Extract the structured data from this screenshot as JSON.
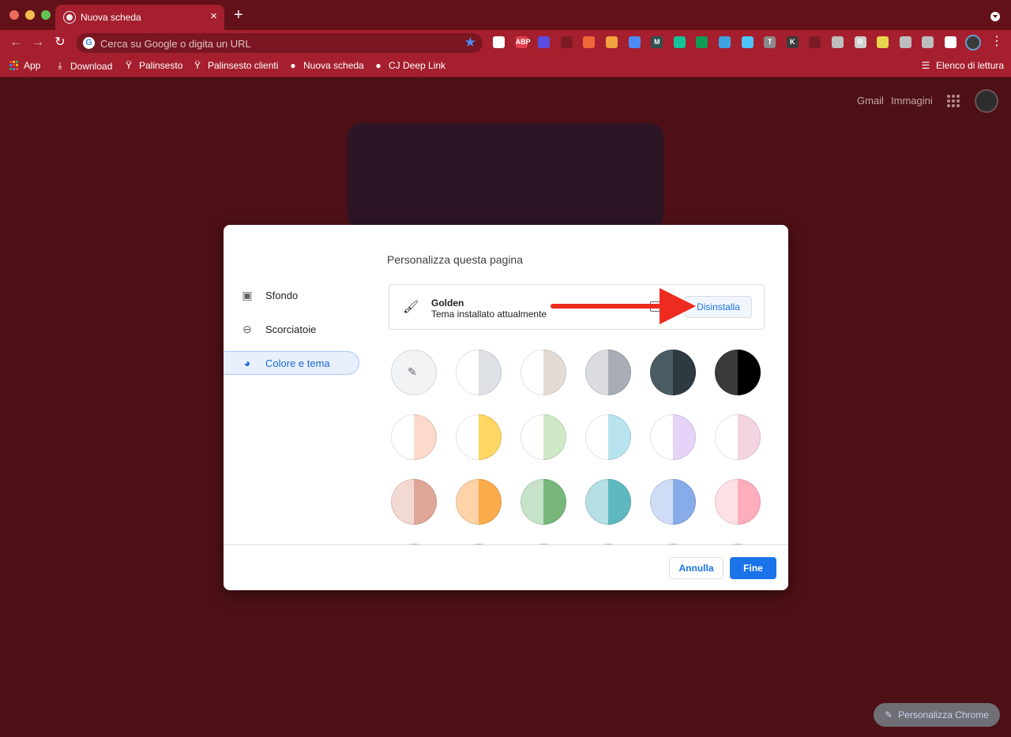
{
  "browser": {
    "tab_title": "Nuova scheda",
    "tab_close": "×",
    "new_tab": "+",
    "omnibox_placeholder": "Cerca su Google o digita un URL",
    "bookmarks": [
      "App",
      "Download",
      "Palinsesto",
      "Palinsesto clienti",
      "Nuova scheda",
      "CJ Deep Link"
    ],
    "reading_list": "Elenco di lettura",
    "extensions": [
      {
        "name": "calendar-ext-icon",
        "glyph": "",
        "color": "#ffffff"
      },
      {
        "name": "adblock-plus-icon",
        "glyph": "ABP",
        "color": "#e63e4a"
      },
      {
        "name": "gem-ext-icon",
        "glyph": "",
        "color": "#5b4de0"
      },
      {
        "name": "extension-icon",
        "glyph": "",
        "color": "#7c1a24"
      },
      {
        "name": "table-ext-icon",
        "glyph": "",
        "color": "#f1683b"
      },
      {
        "name": "face-ext-icon",
        "glyph": "",
        "color": "#f4a340"
      },
      {
        "name": "puzzle-ext-icon",
        "glyph": "",
        "color": "#4c8bf5"
      },
      {
        "name": "m-ext-icon",
        "glyph": "M",
        "color": "#2f4f4f"
      },
      {
        "name": "grammar-ext-icon",
        "glyph": "",
        "color": "#15c39a"
      },
      {
        "name": "lighthouse-ext-icon",
        "glyph": "",
        "color": "#0f9d58"
      },
      {
        "name": "eyedropper-ext-icon",
        "glyph": "",
        "color": "#3fa3e0"
      },
      {
        "name": "gears-ext-icon",
        "glyph": "",
        "color": "#4fc3f7"
      },
      {
        "name": "t-ext-icon",
        "glyph": "T",
        "color": "#8a8a8a"
      },
      {
        "name": "k-ext-icon",
        "glyph": "K",
        "color": "#3b3b3b"
      },
      {
        "name": "function-ext-icon",
        "glyph": "",
        "color": "#7c1a24"
      },
      {
        "name": "window-ext-icon",
        "glyph": "",
        "color": "#bdbdbd"
      },
      {
        "name": "r-ext-icon",
        "glyph": "R",
        "color": "#cfcfcf"
      },
      {
        "name": "pin-ext-icon",
        "glyph": "",
        "color": "#e8d44d"
      },
      {
        "name": "check-ext-icon",
        "glyph": "",
        "color": "#bdbdbd"
      },
      {
        "name": "link-ext-icon",
        "glyph": "",
        "color": "#bdbdbd"
      },
      {
        "name": "puzzle-menu-icon",
        "glyph": "",
        "color": "#ffffff"
      }
    ]
  },
  "ntp": {
    "gmail": "Gmail",
    "images": "Immagini",
    "customize_chrome": "Personalizza Chrome"
  },
  "dialog": {
    "title": "Personalizza questa pagina",
    "sidebar": [
      {
        "key": "background",
        "label": "Sfondo",
        "icon": "image-icon"
      },
      {
        "key": "shortcuts",
        "label": "Scorciatoie",
        "icon": "link-icon"
      },
      {
        "key": "color_theme",
        "label": "Colore e tema",
        "icon": "palette-icon",
        "active": true
      }
    ],
    "theme": {
      "name": "Golden",
      "subtitle": "Tema installato attualmente",
      "uninstall": "Disinstalla"
    },
    "swatches": [
      [
        "#f1f3f4",
        "#f1f3f4"
      ],
      [
        "#ffffff",
        "#dee1e6"
      ],
      [
        "#ffffff",
        "#e3dcd6"
      ],
      [
        "#dadce0",
        "#a9adb5"
      ],
      [
        "#4a5b63",
        "#2e3a40"
      ],
      [
        "#3a3a3a",
        "#000000"
      ],
      [
        "#ffffff",
        "#fbdacc"
      ],
      [
        "#ffffff",
        "#fdd663"
      ],
      [
        "#ffffff",
        "#cfe8c6"
      ],
      [
        "#ffffff",
        "#b8e4ef"
      ],
      [
        "#ffffff",
        "#e5d3f8"
      ],
      [
        "#ffffff",
        "#f5d4e1"
      ],
      [
        "#f2d9d1",
        "#dfa797"
      ],
      [
        "#fdd3a7",
        "#fbab4b"
      ],
      [
        "#c6e3c9",
        "#77b87a"
      ],
      [
        "#b5dfe2",
        "#5db8bf"
      ],
      [
        "#cfdcf6",
        "#88acea"
      ],
      [
        "#fde0e5",
        "#fdadbc"
      ],
      [
        "#dddddd",
        "#cccccc"
      ],
      [
        "#dddddd",
        "#cccccc"
      ],
      [
        "#dddddd",
        "#cccccc"
      ],
      [
        "#dddddd",
        "#cccccc"
      ],
      [
        "#dddddd",
        "#cccccc"
      ],
      [
        "#dddddd",
        "#cccccc"
      ]
    ],
    "cancel": "Annulla",
    "done": "Fine"
  }
}
